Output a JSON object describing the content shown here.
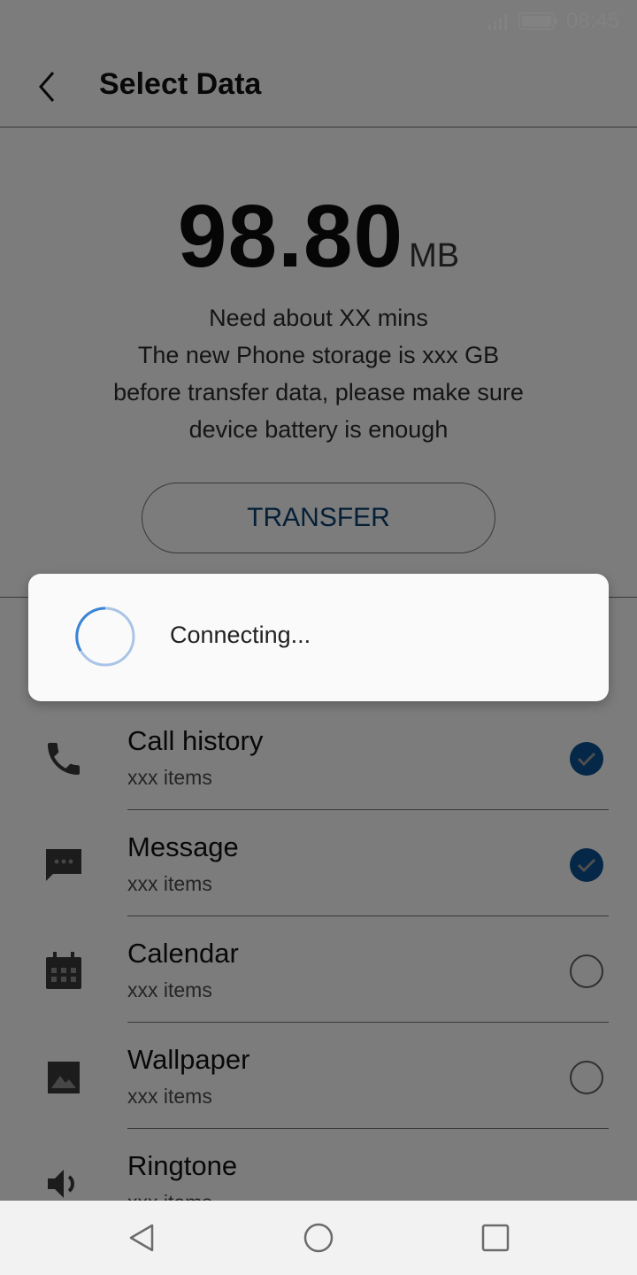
{
  "status": {
    "time": "08:45"
  },
  "header": {
    "title": "Select Data"
  },
  "summary": {
    "size_value": "98.80",
    "size_unit": "MB",
    "line1": "Need about XX mins",
    "line2": "The new Phone storage is xxx GB",
    "line3": "before transfer data, please make sure",
    "line4": "device battery is enough"
  },
  "transfer_label": "TRANSFER",
  "dialog": {
    "text": "Connecting..."
  },
  "items": [
    {
      "name": "Call history",
      "sub": "xxx items",
      "checked": true,
      "icon": "phone-icon"
    },
    {
      "name": "Message",
      "sub": "xxx items",
      "checked": true,
      "icon": "message-icon"
    },
    {
      "name": "Calendar",
      "sub": "xxx items",
      "checked": false,
      "icon": "calendar-icon"
    },
    {
      "name": "Wallpaper",
      "sub": "xxx items",
      "checked": false,
      "icon": "image-icon"
    },
    {
      "name": "Ringtone",
      "sub": "xxx items",
      "checked": false,
      "icon": "speaker-icon"
    }
  ],
  "colors": {
    "accent": "#1a73c8",
    "check_fill": "#1565c0"
  }
}
